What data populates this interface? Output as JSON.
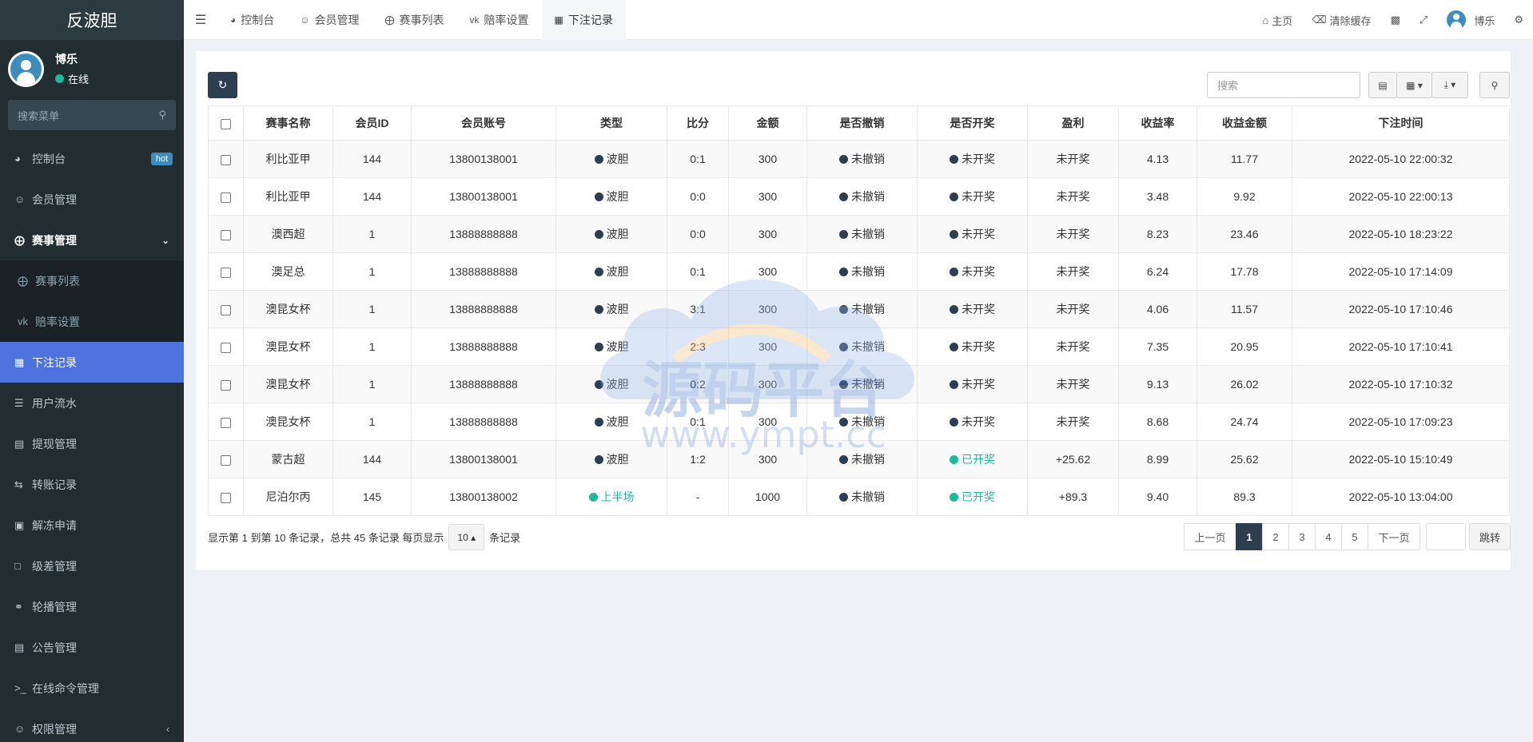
{
  "app": {
    "title": "反波胆"
  },
  "user": {
    "name": "博乐",
    "status": "在线"
  },
  "sidebar": {
    "search_placeholder": "搜索菜单",
    "items": [
      {
        "icon": "dashboard-icon",
        "label": "控制台",
        "badge": "hot"
      },
      {
        "icon": "users-icon",
        "label": "会员管理"
      },
      {
        "icon": "life-ring-icon",
        "label": "赛事管理"
      },
      {
        "icon": "life-ring-icon",
        "label": "赛事列表"
      },
      {
        "icon": "vk-icon",
        "label": "赔率设置"
      },
      {
        "icon": "calendar-icon",
        "label": "下注记录"
      },
      {
        "icon": "list-icon",
        "label": "用户流水"
      },
      {
        "icon": "list-alt-icon",
        "label": "提现管理"
      },
      {
        "icon": "exchange-icon",
        "label": "转账记录"
      },
      {
        "icon": "image-icon",
        "label": "解冻申请"
      },
      {
        "icon": "window-icon",
        "label": "级差管理"
      },
      {
        "icon": "balloon-icon",
        "label": "轮播管理"
      },
      {
        "icon": "newspaper-icon",
        "label": "公告管理"
      },
      {
        "icon": "terminal-icon",
        "label": "在线命令管理"
      },
      {
        "icon": "users-icon",
        "label": "权限管理"
      }
    ]
  },
  "topbar": {
    "tabs": [
      {
        "icon": "dashboard-icon",
        "label": "控制台"
      },
      {
        "icon": "users-icon",
        "label": "会员管理"
      },
      {
        "icon": "life-ring-icon",
        "label": "赛事列表"
      },
      {
        "icon": "vk-icon",
        "label": "赔率设置"
      },
      {
        "icon": "calendar-icon",
        "label": "下注记录"
      }
    ],
    "home": "主页",
    "clear_cache": "清除缓存",
    "user_name": "博乐"
  },
  "toolbar": {
    "search_placeholder": "搜索"
  },
  "table": {
    "headers": [
      "赛事名称",
      "会员ID",
      "会员账号",
      "类型",
      "比分",
      "金额",
      "是否撤销",
      "是否开奖",
      "盈利",
      "收益率",
      "收益金额",
      "下注时间"
    ],
    "rows": [
      [
        "利比亚甲",
        "144",
        "13800138001",
        "波胆",
        "0:1",
        "300",
        "未撤销",
        "未开奖",
        "未开奖",
        "4.13",
        "11.77",
        "2022-05-10 22:00:32"
      ],
      [
        "利比亚甲",
        "144",
        "13800138001",
        "波胆",
        "0:0",
        "300",
        "未撤销",
        "未开奖",
        "未开奖",
        "3.48",
        "9.92",
        "2022-05-10 22:00:13"
      ],
      [
        "澳西超",
        "1",
        "13888888888",
        "波胆",
        "0:0",
        "300",
        "未撤销",
        "未开奖",
        "未开奖",
        "8.23",
        "23.46",
        "2022-05-10 18:23:22"
      ],
      [
        "澳足总",
        "1",
        "13888888888",
        "波胆",
        "0:1",
        "300",
        "未撤销",
        "未开奖",
        "未开奖",
        "6.24",
        "17.78",
        "2022-05-10 17:14:09"
      ],
      [
        "澳昆女杯",
        "1",
        "13888888888",
        "波胆",
        "3:1",
        "300",
        "未撤销",
        "未开奖",
        "未开奖",
        "4.06",
        "11.57",
        "2022-05-10 17:10:46"
      ],
      [
        "澳昆女杯",
        "1",
        "13888888888",
        "波胆",
        "2:3",
        "300",
        "未撤销",
        "未开奖",
        "未开奖",
        "7.35",
        "20.95",
        "2022-05-10 17:10:41"
      ],
      [
        "澳昆女杯",
        "1",
        "13888888888",
        "波胆",
        "0:2",
        "300",
        "未撤销",
        "未开奖",
        "未开奖",
        "9.13",
        "26.02",
        "2022-05-10 17:10:32"
      ],
      [
        "澳昆女杯",
        "1",
        "13888888888",
        "波胆",
        "0:1",
        "300",
        "未撤销",
        "未开奖",
        "未开奖",
        "8.68",
        "24.74",
        "2022-05-10 17:09:23"
      ],
      [
        "蒙古超",
        "144",
        "13800138001",
        "波胆",
        "1:2",
        "300",
        "未撤销",
        "已开奖",
        "+25.62",
        "8.99",
        "25.62",
        "2022-05-10 15:10:49"
      ],
      [
        "尼泊尔丙",
        "145",
        "13800138002",
        "上半场",
        "-",
        "1000",
        "未撤销",
        "已开奖",
        "+89.3",
        "9.40",
        "89.3",
        "2022-05-10 13:04:00"
      ]
    ]
  },
  "pager": {
    "info_prefix": "显示第 1 到第 10 条记录，总共 45 条记录 每页显示",
    "page_size": "10",
    "info_suffix": "条记录",
    "prev": "上一页",
    "pages": [
      "1",
      "2",
      "3",
      "4",
      "5"
    ],
    "next": "下一页",
    "jump": "跳转"
  },
  "watermark": {
    "line1": "源码平台",
    "line2": "www.ympt.cc"
  }
}
